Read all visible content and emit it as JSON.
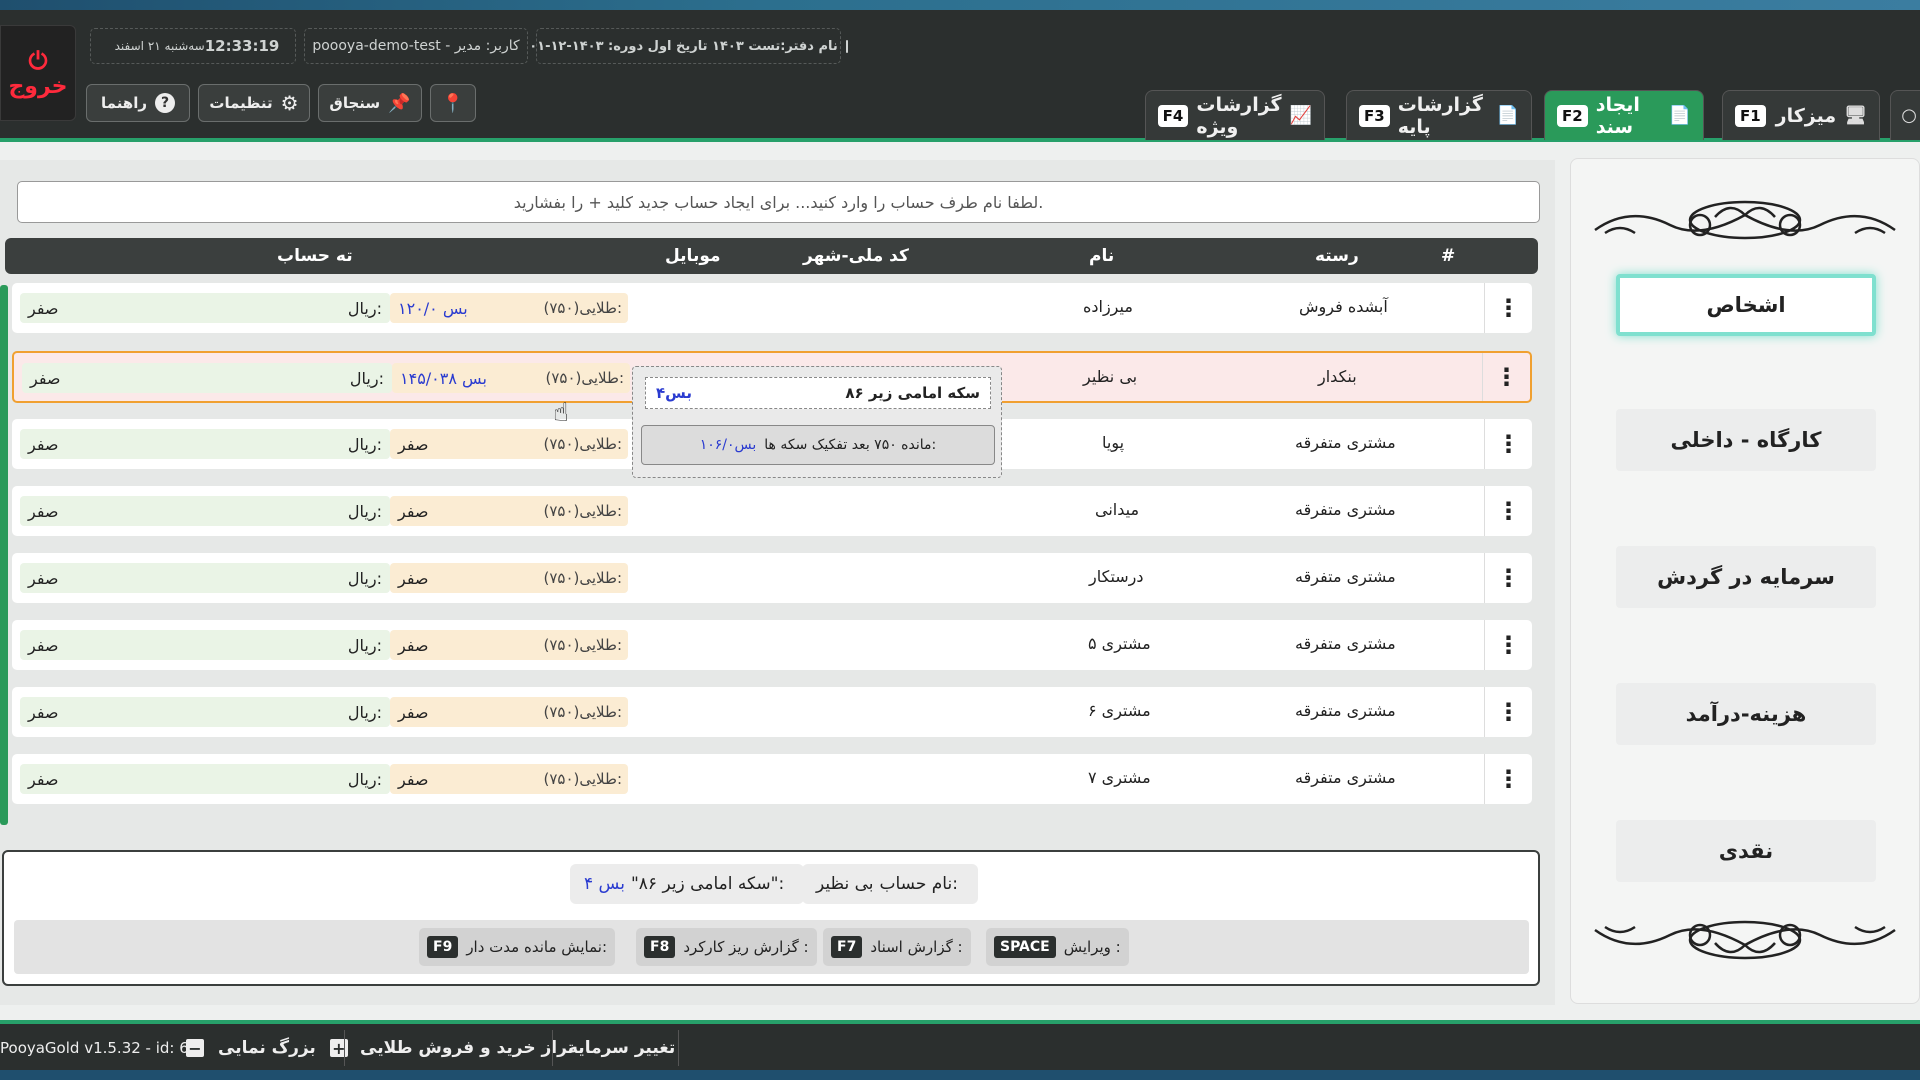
{
  "header": {
    "exit_label": "خروج",
    "clock": "12:33:19",
    "date": "سه‌شنبه ۲۱ اسفند",
    "user": "poooya-demo-test - کاربر: مدیر",
    "book": "نام دفتر:تست ۱۴۰۳  تاریخ اول دوره: ۱۴۰۳-۱۲-۰۱"
  },
  "toolbar": {
    "help_label": "راهنما",
    "settings_label": "تنظیمات",
    "pin_label": "سنجاق"
  },
  "tabs": [
    {
      "label": "میزکار",
      "key": "F1"
    },
    {
      "label": "ایجاد سند",
      "key": "F2"
    },
    {
      "label": "گزارشات پایه",
      "key": "F3"
    },
    {
      "label": "گزارشات ویژه",
      "key": "F4"
    }
  ],
  "search": {
    "placeholder": "لطفا نام طرف حساب را وارد کنید... برای ایجاد حساب جدید کلید + را بفشارید."
  },
  "table": {
    "headers": {
      "hash": "#",
      "category": "رسته",
      "name": "نام",
      "code": "کد ملی-شهر",
      "mobile": "موبایل",
      "balance": "ته حساب"
    },
    "rows": [
      {
        "category": "آبشده فروش",
        "name": "میرزاده",
        "gold_label": "طلایی(۷۵۰):",
        "gold_value": "۱۲۰/۰ بس",
        "rial_label": "ریال:",
        "rial_value": "صفر"
      },
      {
        "category": "بنکدار",
        "name": "بی نظیر",
        "gold_label": "طلایی(۷۵۰):",
        "gold_value": "۱۴۵/۰۳۸ بس",
        "rial_label": "ریال:",
        "rial_value": "صفر"
      },
      {
        "category": "مشتری متفرقه",
        "name": "پویا",
        "gold_label": "طلایی(۷۵۰):",
        "gold_value": "صفر",
        "rial_label": "ریال:",
        "rial_value": "صفر"
      },
      {
        "category": "مشتری متفرقه",
        "name": "میدانی",
        "gold_label": "طلایی(۷۵۰):",
        "gold_value": "صفر",
        "rial_label": "ریال:",
        "rial_value": "صفر"
      },
      {
        "category": "مشتری متفرقه",
        "name": "درستکار",
        "gold_label": "طلایی(۷۵۰):",
        "gold_value": "صفر",
        "rial_label": "ریال:",
        "rial_value": "صفر"
      },
      {
        "category": "مشتری متفرقه",
        "name": "مشتری ۵",
        "gold_label": "طلایی(۷۵۰):",
        "gold_value": "صفر",
        "rial_label": "ریال:",
        "rial_value": "صفر"
      },
      {
        "category": "مشتری متفرقه",
        "name": "مشتری ۶",
        "gold_label": "طلایی(۷۵۰):",
        "gold_value": "صفر",
        "rial_label": "ریال:",
        "rial_value": "صفر"
      },
      {
        "category": "مشتری متفرقه",
        "name": "مشتری ۷",
        "gold_label": "طلایی(۷۵۰):",
        "gold_value": "صفر",
        "rial_label": "ریال:",
        "rial_value": "صفر"
      }
    ]
  },
  "popup": {
    "line1_label": "سکه امامی زیر ۸۶",
    "line1_value": "۴بس",
    "line2_label": "مانده ۷۵۰ بعد تفکیک سکه ها:",
    "line2_value": "۱۰۶/۰بس"
  },
  "footer": {
    "account_label": "نام حساب:",
    "account_value": "بی نظیر",
    "coin_label": "\"سکه امامی زیر ۸۶\":",
    "coin_value": "۴ بس",
    "keys": [
      {
        "label": "ویرایش :",
        "key": "SPACE"
      },
      {
        "label": "گزارش اسناد :",
        "key": "F7"
      },
      {
        "label": "گزارش ریز کارکرد :",
        "key": "F8"
      },
      {
        "label": "نمایش مانده مدت دار:",
        "key": "F9"
      }
    ]
  },
  "sidebar": {
    "items": [
      "اشخاص",
      "کارگاه - داخلی",
      "سرمایه در گردش",
      "هزینه-درآمد",
      "نقدی"
    ]
  },
  "bottombar": {
    "version": "PooyaGold v1.5.32 - id: 6",
    "zoom_label": "بزرگ نمایی",
    "zoom_minus": "−",
    "zoom_plus": "+",
    "balance_label": "تراز خرید و فروش طلایی",
    "capital_label": "تغییر سرمایه"
  }
}
